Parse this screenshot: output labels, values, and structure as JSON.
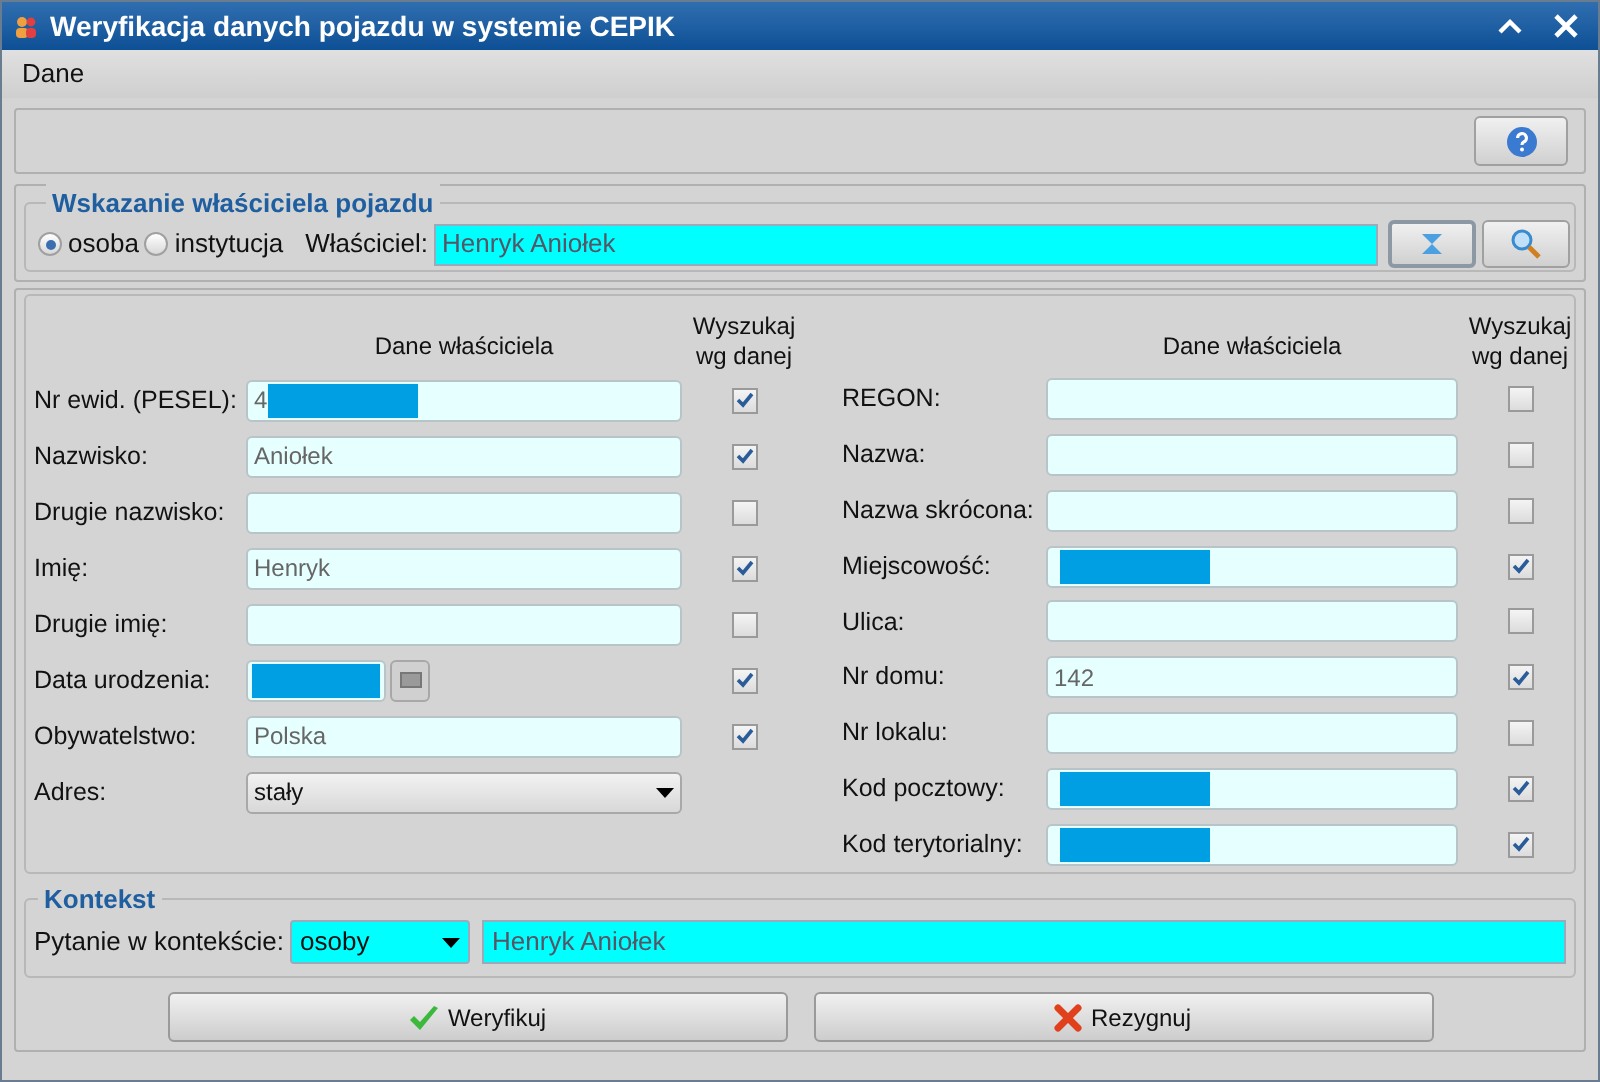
{
  "window": {
    "title": "Weryfikacja danych pojazdu w systemie CEPIK"
  },
  "menu": [
    {
      "label": "Dane"
    }
  ],
  "owner_section": {
    "title": "Wskazanie właściciela pojazdu",
    "options": [
      {
        "label": "osoba",
        "selected": true
      },
      {
        "label": "instytucja",
        "selected": false
      }
    ],
    "owner_label": "Właściciel:",
    "owner_value": "Henryk Aniołek"
  },
  "person": {
    "header": "Dane właściciela",
    "search_header": "Wyszukaj wg danej",
    "rows": [
      {
        "kind": "text",
        "label": "Nr ewid. (PESEL):",
        "value": "4",
        "redacted": true,
        "checked": true
      },
      {
        "kind": "text",
        "label": "Nazwisko:",
        "value": "Aniołek",
        "redacted": false,
        "checked": true
      },
      {
        "kind": "text",
        "label": "Drugie nazwisko:",
        "redacted": false,
        "checked": false
      },
      {
        "kind": "text",
        "label": "Imię:",
        "value": "Henryk",
        "redacted": false,
        "checked": true
      },
      {
        "kind": "text",
        "label": "Drugie imię:",
        "redacted": false,
        "checked": false
      },
      {
        "kind": "date",
        "label": "Data urodzenia:",
        "redacted": true,
        "checked": true
      },
      {
        "kind": "text",
        "label": "Obywatelstwo:",
        "value": "Polska",
        "redacted": false,
        "checked": true
      },
      {
        "kind": "select",
        "label": "Adres:",
        "value": "stały"
      }
    ]
  },
  "institution": {
    "header": "Dane właściciela",
    "search_header": "Wyszukaj wg danej",
    "rows": [
      {
        "kind": "text",
        "label": "REGON:",
        "redacted": false,
        "checked": false
      },
      {
        "kind": "text",
        "label": "Nazwa:",
        "redacted": false,
        "checked": false
      },
      {
        "kind": "text",
        "label": "Nazwa skrócona:",
        "redacted": false,
        "checked": false
      },
      {
        "kind": "text",
        "label": "Miejscowość:",
        "redacted": true,
        "checked": true
      },
      {
        "kind": "text",
        "label": "Ulica:",
        "redacted": false,
        "checked": false
      },
      {
        "kind": "text",
        "label": "Nr domu:",
        "value": "142",
        "redacted": false,
        "checked": true
      },
      {
        "kind": "text",
        "label": "Nr lokalu:",
        "redacted": false,
        "checked": false
      },
      {
        "kind": "text",
        "label": "Kod pocztowy:",
        "redacted": true,
        "checked": true
      },
      {
        "kind": "text",
        "label": "Kod terytorialny:",
        "redacted": true,
        "checked": true
      }
    ]
  },
  "context": {
    "title": "Kontekst",
    "label": "Pytanie w kontekście:",
    "select_value": "osoby",
    "value": "Henryk Aniołek"
  },
  "buttons": [
    {
      "kind": "ok",
      "label": "Weryfikuj"
    },
    {
      "kind": "cancel",
      "label": "Rezygnuj"
    }
  ]
}
